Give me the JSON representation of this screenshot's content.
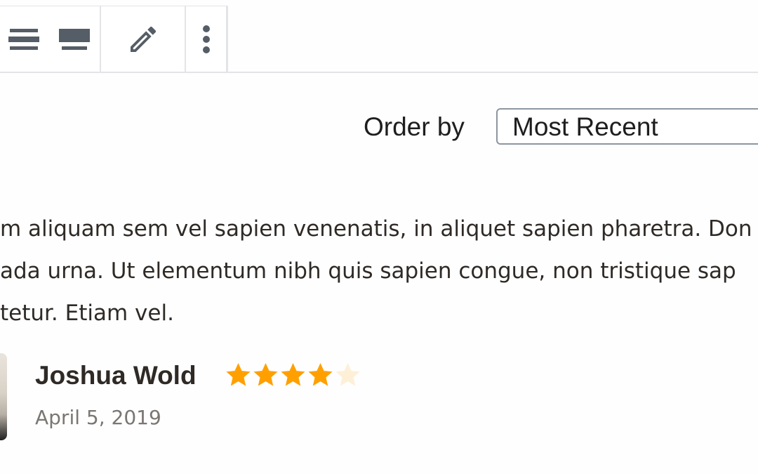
{
  "toolbar": {
    "buttons": [
      {
        "icon": "align-wide-icon"
      },
      {
        "icon": "align-full-icon"
      },
      {
        "icon": "pencil-icon"
      },
      {
        "icon": "more-options-icon"
      }
    ]
  },
  "order": {
    "label": "Order by",
    "selected": "Most Recent"
  },
  "review": {
    "text_lines": [
      "m aliquam sem vel sapien venenatis, in aliquet sapien pharetra. Don",
      "ada urna. Ut elementum nibh quis sapien congue, non tristique sap",
      "tetur. Etiam vel."
    ],
    "author": "Joshua Wold",
    "date": "April 5, 2019",
    "rating": 4,
    "rating_max": 5
  },
  "colors": {
    "star_filled": "#ffa000",
    "star_empty": "#fdf0d7",
    "icon": "#555d66"
  }
}
